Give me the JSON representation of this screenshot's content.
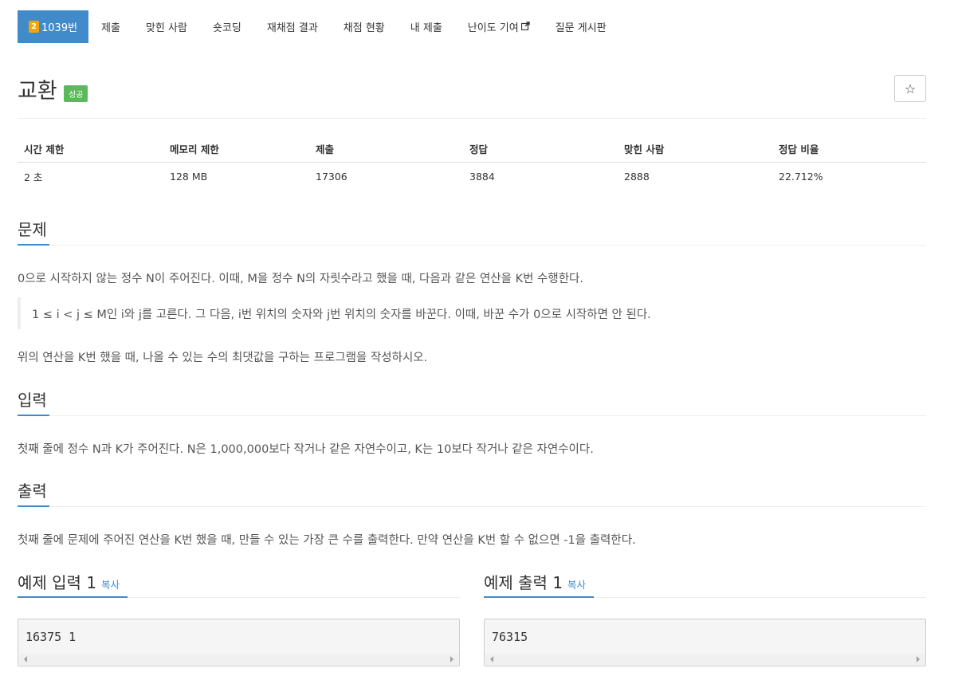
{
  "nav": {
    "tier_label": "2",
    "items": [
      "1039번",
      "제출",
      "맞힌 사람",
      "숏코딩",
      "재채점 결과",
      "채점 현황",
      "내 제출",
      "난이도 기여",
      "질문 게시판"
    ],
    "external_icon": "external-link-icon"
  },
  "problem": {
    "title": "교환",
    "badge": "성공",
    "star_icon": "star-icon",
    "star_glyph": "☆"
  },
  "info_table": {
    "headers": [
      "시간 제한",
      "메모리 제한",
      "제출",
      "정답",
      "맞힌 사람",
      "정답 비율"
    ],
    "values": [
      "2 초",
      "128 MB",
      "17306",
      "3884",
      "2888",
      "22.712%"
    ]
  },
  "sections": {
    "problem_heading": "문제",
    "problem_text": "0으로 시작하지 않는 정수 N이 주어진다. 이때, M을 정수 N의 자릿수라고 했을 때, 다음과 같은 연산을 K번 수행한다.",
    "problem_quote": "1 ≤ i < j ≤ M인 i와 j를 고른다. 그 다음, i번 위치의 숫자와 j번 위치의 숫자를 바꾼다. 이때, 바꾼 수가 0으로 시작하면 안 된다.",
    "problem_text2": "위의 연산을 K번 했을 때, 나올 수 있는 수의 최댓값을 구하는 프로그램을 작성하시오.",
    "input_heading": "입력",
    "input_text": "첫째 줄에 정수 N과 K가 주어진다. N은 1,000,000보다 작거나 같은 자연수이고, K는 10보다 작거나 같은 자연수이다.",
    "output_heading": "출력",
    "output_text": "첫째 줄에 문제에 주어진 연산을 K번 했을 때, 만들 수 있는 가장 큰 수를 출력한다. 만약 연산을 K번 할 수 없으면 -1을 출력한다."
  },
  "samples": {
    "input_heading": "예제 입력 1",
    "output_heading": "예제 출력 1",
    "copy_label": "복사",
    "input_value": "16375 1",
    "output_value": "76315"
  }
}
